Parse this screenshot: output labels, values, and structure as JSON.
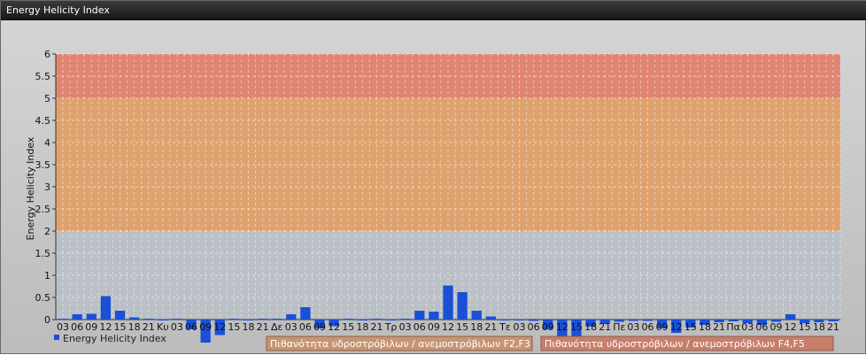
{
  "window": {
    "title": "Energy Helicity Index"
  },
  "chart_data": {
    "type": "bar",
    "ylabel": "Energy Helicity Index",
    "ylim": [
      0,
      6
    ],
    "yticks": [
      0,
      0.5,
      1,
      1.5,
      2,
      2.5,
      3,
      3.5,
      4,
      4.5,
      5,
      5.5,
      6
    ],
    "grid": true,
    "colors": {
      "bar": "#1a4fd6",
      "band_low": "#b9bec4",
      "band_mid": "#e0a06a",
      "band_high": "#e2826e"
    },
    "bands": [
      {
        "from": 0,
        "to": 2
      },
      {
        "from": 2,
        "to": 5,
        "label": "Πιθανότητα υδροστρόβιλων / ανεμοστρόβιλων F2,F3"
      },
      {
        "from": 5,
        "to": 6,
        "label": "Πιθανότητα υδροστρόβιλων / ανεμοστρόβιλων F4,F5"
      }
    ],
    "categories": [
      "03",
      "06",
      "09",
      "12",
      "15",
      "18",
      "21",
      "Κυ",
      "03",
      "06",
      "09",
      "12",
      "15",
      "18",
      "21",
      "Δε",
      "03",
      "06",
      "09",
      "12",
      "15",
      "18",
      "21",
      "Τρ",
      "03",
      "06",
      "09",
      "12",
      "15",
      "18",
      "21",
      "Τε",
      "03",
      "06",
      "09",
      "12",
      "15",
      "18",
      "21",
      "Πε",
      "03",
      "06",
      "09",
      "12",
      "15",
      "18",
      "21",
      "Πα",
      "03",
      "06",
      "09",
      "12",
      "15",
      "18",
      "21"
    ],
    "series": [
      {
        "name": "Energy Helicity Index",
        "values": [
          0.02,
          0.12,
          0.13,
          0.53,
          0.2,
          0.05,
          0.02,
          0.01,
          0.02,
          -0.22,
          -0.52,
          -0.35,
          0.02,
          0.01,
          0.02,
          0.02,
          0.12,
          0.28,
          -0.2,
          -0.15,
          0.02,
          0.01,
          0.02,
          0.01,
          0.02,
          0.2,
          0.18,
          0.77,
          0.62,
          0.2,
          0.07,
          0.01,
          0.01,
          -0.02,
          -0.22,
          -0.55,
          -0.42,
          -0.16,
          -0.1,
          -0.05,
          -0.03,
          -0.02,
          -0.2,
          -0.3,
          -0.18,
          -0.12,
          -0.06,
          -0.04,
          -0.08,
          -0.12,
          -0.05,
          0.12,
          -0.08,
          -0.06,
          -0.04
        ]
      }
    ]
  }
}
